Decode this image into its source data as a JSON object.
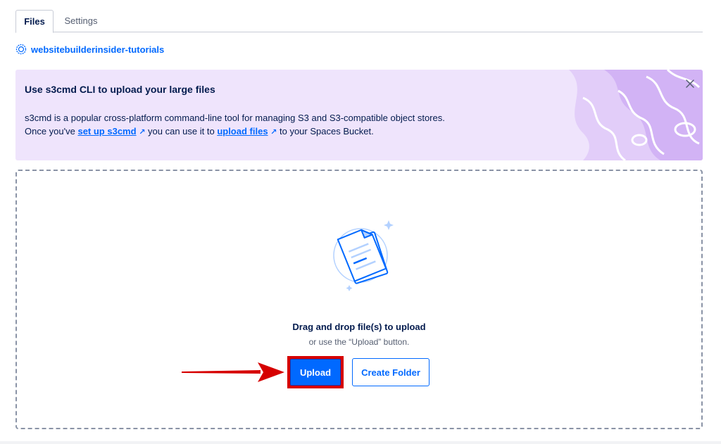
{
  "tabs": [
    {
      "label": "Files",
      "active": true
    },
    {
      "label": "Settings",
      "active": false
    }
  ],
  "bucket": {
    "name": "websitebuilderinsider-tutorials",
    "icon": "bucket-icon"
  },
  "banner": {
    "title": "Use s3cmd CLI to upload your large files",
    "line1": "s3cmd is a popular cross-platform command-line tool for managing S3 and S3-compatible object stores.",
    "line2_prefix": "Once you've ",
    "link1": "set up s3cmd",
    "line2_middle": " you can use it to ",
    "link2": "upload files",
    "line2_suffix": " to your Spaces Bucket.",
    "ext_glyph": "↗"
  },
  "dropzone": {
    "title": "Drag and drop file(s) to upload",
    "subtitle": "or use the “Upload” button.",
    "upload_label": "Upload",
    "create_folder_label": "Create Folder"
  },
  "colors": {
    "accent": "#0069ff",
    "banner_bg": "#efe4fc",
    "highlight": "#d60000"
  }
}
